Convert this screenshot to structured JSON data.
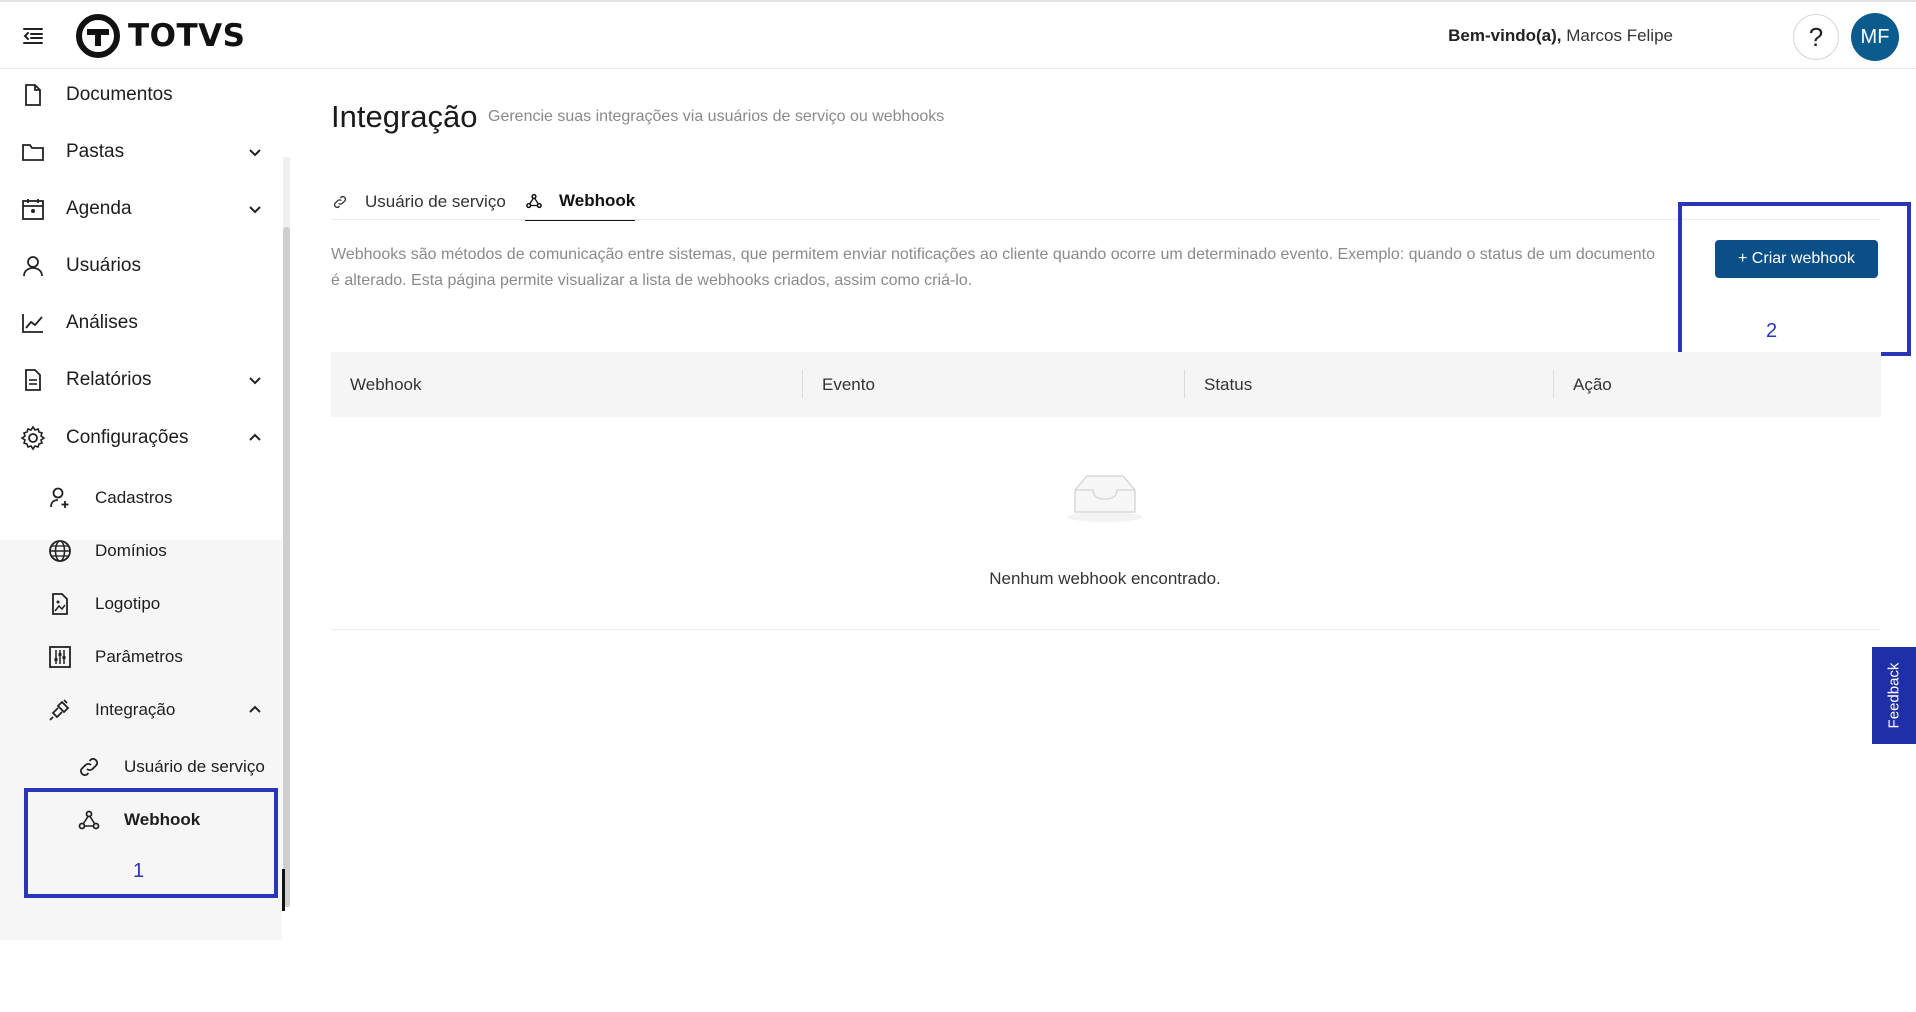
{
  "header": {
    "logo_text": "TOTVS",
    "welcome_prefix": "Bem-vindo(a),",
    "user_name": "Marcos Felipe",
    "help_label": "?",
    "avatar_initials": "MF"
  },
  "sidebar": {
    "items": [
      {
        "label": "Documentos"
      },
      {
        "label": "Pastas"
      },
      {
        "label": "Agenda"
      },
      {
        "label": "Usuários"
      },
      {
        "label": "Análises"
      },
      {
        "label": "Relatórios"
      },
      {
        "label": "Configurações"
      }
    ],
    "config_sub": [
      {
        "label": "Cadastros"
      },
      {
        "label": "Domínios"
      },
      {
        "label": "Logotipo"
      },
      {
        "label": "Parâmetros"
      },
      {
        "label": "Integração"
      }
    ],
    "integration_sub": [
      {
        "label": "Usuário de serviço"
      },
      {
        "label": "Webhook"
      }
    ]
  },
  "annotations": {
    "box1": "1",
    "box2": "2",
    "color": "#2a36b8"
  },
  "main": {
    "title": "Integração",
    "subtitle": "Gerencie suas integrações via usuários de serviço ou webhooks",
    "tabs": [
      {
        "label": "Usuário de serviço",
        "active": false
      },
      {
        "label": "Webhook",
        "active": true
      }
    ],
    "description": "Webhooks são métodos de comunicação entre sistemas, que permitem enviar notificações ao cliente quando ocorre um determinado evento. Exemplo: quando o status de um documento é alterado. Esta página permite visualizar a lista de webhooks criados, assim como criá-lo.",
    "create_button": "+ Criar webhook",
    "table": {
      "columns": [
        "Webhook",
        "Evento",
        "Status",
        "Ação"
      ],
      "empty_text": "Nenhum webhook encontrado."
    }
  },
  "feedback_label": "Feedback",
  "colors": {
    "primary": "#0b4f88",
    "avatar": "#0b5b8c",
    "feedback": "#1f2fa8"
  }
}
